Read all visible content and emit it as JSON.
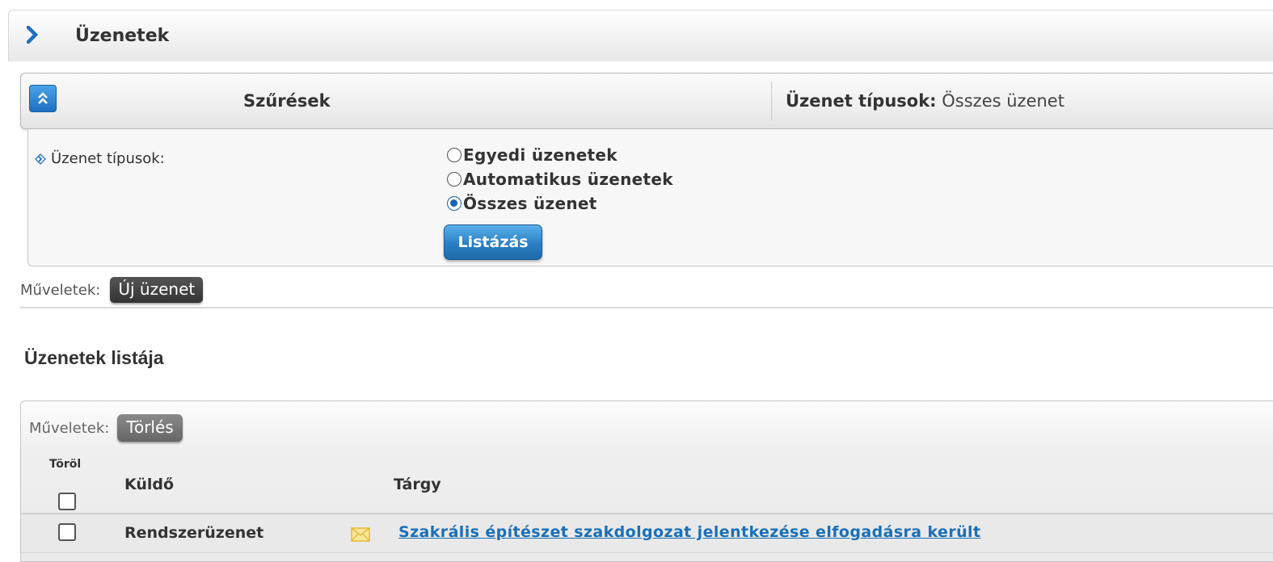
{
  "header": {
    "title": "Üzenetek",
    "icon": "chevron-right-icon"
  },
  "filter": {
    "title": "Szűrések",
    "summary_label": "Üzenet típusok:",
    "summary_value": "Összes üzenet",
    "field_label": "Üzenet típusok:",
    "options": [
      {
        "label": "Egyedi üzenetek",
        "checked": false
      },
      {
        "label": "Automatikus üzenetek",
        "checked": false
      },
      {
        "label": "Összes üzenet",
        "checked": true
      }
    ],
    "list_button": "Listázás"
  },
  "actions": {
    "label": "Műveletek:",
    "new_message_button": "Új üzenet"
  },
  "list": {
    "title": "Üzenetek listája",
    "ops_label": "Műveletek:",
    "delete_button": "Törlés",
    "columns": {
      "delete": "Töröl",
      "sender": "Küldő",
      "subject": "Tárgy"
    },
    "rows": [
      {
        "sender": "Rendszerüzenet",
        "subject": "Szakrális építészet szakdolgozat jelentkezése elfogadásra került",
        "checked": false
      }
    ]
  },
  "colors": {
    "accent": "#1e6fc0",
    "link": "#1a6fb8",
    "mail_icon": "#f2c744"
  }
}
